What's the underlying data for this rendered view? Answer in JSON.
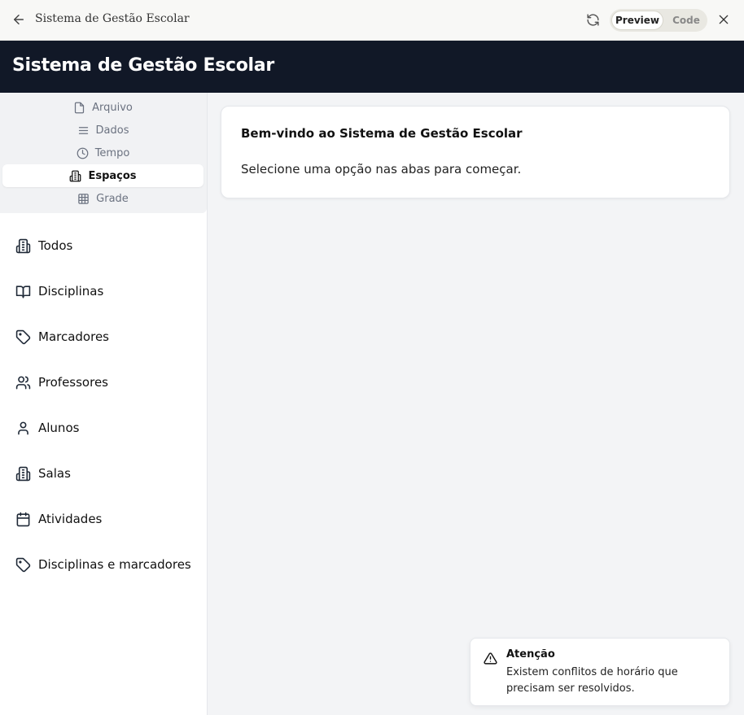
{
  "window": {
    "title": "Sistema de Gestão Escolar",
    "view_toggle": {
      "preview_label": "Preview",
      "code_label": "Code",
      "selected": "Preview"
    }
  },
  "header": {
    "title": "Sistema de Gestão Escolar"
  },
  "tabs": [
    {
      "label": "Arquivo",
      "icon": "file-icon",
      "active": false
    },
    {
      "label": "Dados",
      "icon": "list-icon",
      "active": false
    },
    {
      "label": "Tempo",
      "icon": "clock-icon",
      "active": false
    },
    {
      "label": "Espaços",
      "icon": "building-icon",
      "active": true
    },
    {
      "label": "Grade",
      "icon": "grid-icon",
      "active": false
    }
  ],
  "sidebar": {
    "items": [
      {
        "label": "Todos",
        "icon": "building-icon"
      },
      {
        "label": "Disciplinas",
        "icon": "book-icon"
      },
      {
        "label": "Marcadores",
        "icon": "tag-icon"
      },
      {
        "label": "Professores",
        "icon": "users-icon"
      },
      {
        "label": "Alunos",
        "icon": "user-icon"
      },
      {
        "label": "Salas",
        "icon": "building-icon"
      },
      {
        "label": "Atividades",
        "icon": "calendar-icon"
      },
      {
        "label": "Disciplinas e marcadores",
        "icon": "tag-icon"
      }
    ]
  },
  "main": {
    "welcome_title": "Bem-vindo ao Sistema de Gestão Escolar",
    "welcome_text": "Selecione uma opção nas abas para começar."
  },
  "toast": {
    "title": "Atenção",
    "message": "Existem conflitos de horário que precisam ser resolvidos.",
    "icon": "warning-icon"
  }
}
